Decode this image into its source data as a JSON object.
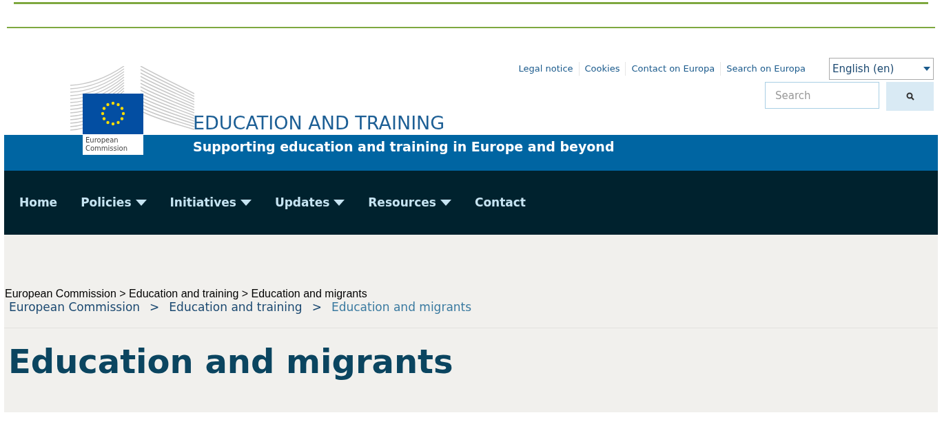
{
  "logo": {
    "caption": "European Commission"
  },
  "top_links": [
    "Legal notice",
    "Cookies",
    "Contact on Europa",
    "Search on Europa"
  ],
  "language": {
    "value": "English (en)"
  },
  "search": {
    "placeholder": "Search"
  },
  "site": {
    "title": "EDUCATION AND TRAINING",
    "tagline": "Supporting education and training in Europe and beyond"
  },
  "nav": [
    {
      "label": "Home",
      "has_menu": false
    },
    {
      "label": "Policies",
      "has_menu": true
    },
    {
      "label": "Initiatives",
      "has_menu": true
    },
    {
      "label": "Updates",
      "has_menu": true
    },
    {
      "label": "Resources",
      "has_menu": true
    },
    {
      "label": "Contact",
      "has_menu": false
    }
  ],
  "breadcrumb_plain": "European Commission > Education and training > Education and migrants",
  "breadcrumb_separator": ">",
  "breadcrumb": [
    {
      "label": "European Commission",
      "current": false
    },
    {
      "label": "Education and training",
      "current": false
    },
    {
      "label": "Education and migrants",
      "current": true
    }
  ],
  "page_title": "Education and migrants"
}
